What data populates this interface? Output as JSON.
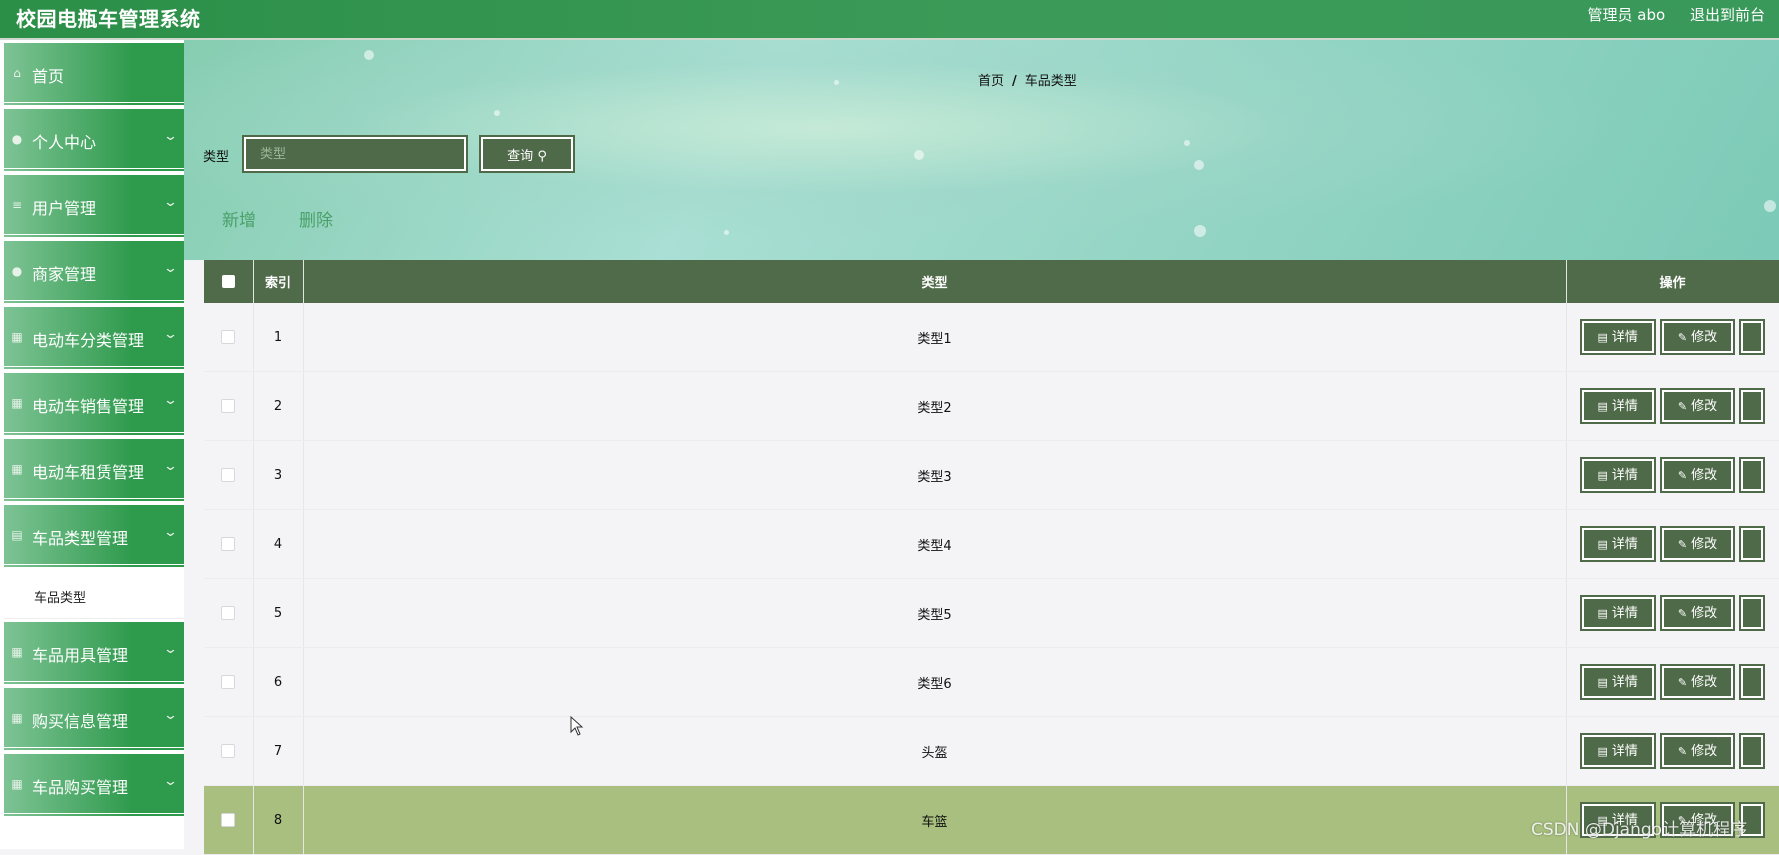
{
  "header": {
    "title": "校园电瓶车管理系统",
    "user": "管理员 abo",
    "logout": "退出到前台"
  },
  "sidebar": {
    "items": [
      {
        "label": "首页",
        "icon": "home-icon"
      },
      {
        "label": "个人中心",
        "icon": "user-icon"
      },
      {
        "label": "用户管理",
        "icon": "list-icon"
      },
      {
        "label": "商家管理",
        "icon": "user-icon"
      },
      {
        "label": "电动车分类管理",
        "icon": "grid-icon"
      },
      {
        "label": "电动车销售管理",
        "icon": "grid-icon"
      },
      {
        "label": "电动车租赁管理",
        "icon": "grid-icon"
      },
      {
        "label": "车品类型管理",
        "icon": "chart-icon"
      },
      {
        "label": "车品用具管理",
        "icon": "grid-icon"
      },
      {
        "label": "购买信息管理",
        "icon": "grid-icon"
      },
      {
        "label": "车品购买管理",
        "icon": "grid-icon"
      }
    ],
    "sub_item": "车品类型"
  },
  "breadcrumb": {
    "home": "首页",
    "sep": "/",
    "current": "车品类型"
  },
  "search": {
    "label": "类型",
    "placeholder": "类型",
    "button": "查询"
  },
  "actions": {
    "add": "新增",
    "delete": "删除"
  },
  "table": {
    "headers": {
      "index": "索引",
      "type": "类型",
      "ops": "操作"
    },
    "rows": [
      {
        "index": "1",
        "type": "类型1"
      },
      {
        "index": "2",
        "type": "类型2"
      },
      {
        "index": "3",
        "type": "类型3"
      },
      {
        "index": "4",
        "type": "类型4"
      },
      {
        "index": "5",
        "type": "类型5"
      },
      {
        "index": "6",
        "type": "类型6"
      },
      {
        "index": "7",
        "type": "头盔"
      },
      {
        "index": "8",
        "type": "车篮"
      }
    ],
    "ops": {
      "detail": "详情",
      "edit": "修改"
    }
  },
  "watermark": "CSDN @Django计算机程序",
  "colors": {
    "header_green": "#2b8f48",
    "button_green": "#4f6a49",
    "highlight_row": "#a8bf7f",
    "link_green": "#4aa068"
  }
}
